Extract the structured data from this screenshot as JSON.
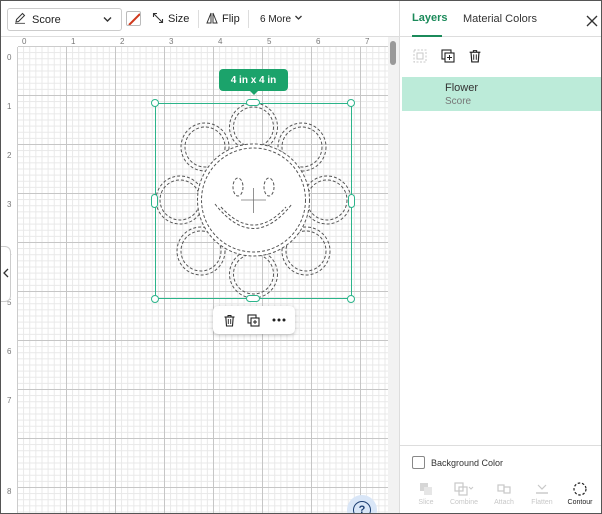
{
  "toolbar": {
    "operation": {
      "label": "Score"
    },
    "size_label": "Size",
    "flip_label": "Flip",
    "more_label": "6 More"
  },
  "ruler": {
    "top_numbers": [
      "0",
      "1",
      "2",
      "3",
      "4",
      "5",
      "6",
      "7"
    ],
    "left_numbers": [
      "0",
      "1",
      "2",
      "3",
      "4",
      "5",
      "6",
      "7",
      "8"
    ]
  },
  "canvas": {
    "size_badge": "4 in x 4 in"
  },
  "panel": {
    "tabs": [
      {
        "label": "Layers",
        "active": true
      },
      {
        "label": "Material Colors",
        "active": false
      }
    ],
    "layers": [
      {
        "name": "Flower",
        "operation": "Score"
      }
    ],
    "background_color_label": "Background Color",
    "bottom_tools": [
      {
        "label": "Slice",
        "enabled": false
      },
      {
        "label": "Combine",
        "enabled": false
      },
      {
        "label": "Attach",
        "enabled": false
      },
      {
        "label": "Flatten",
        "enabled": false
      },
      {
        "label": "Contour",
        "enabled": true
      }
    ]
  },
  "colors": {
    "accent": "#1ba36b",
    "selection": "#2cb48a",
    "layer_highlight": "#bcebd9"
  }
}
